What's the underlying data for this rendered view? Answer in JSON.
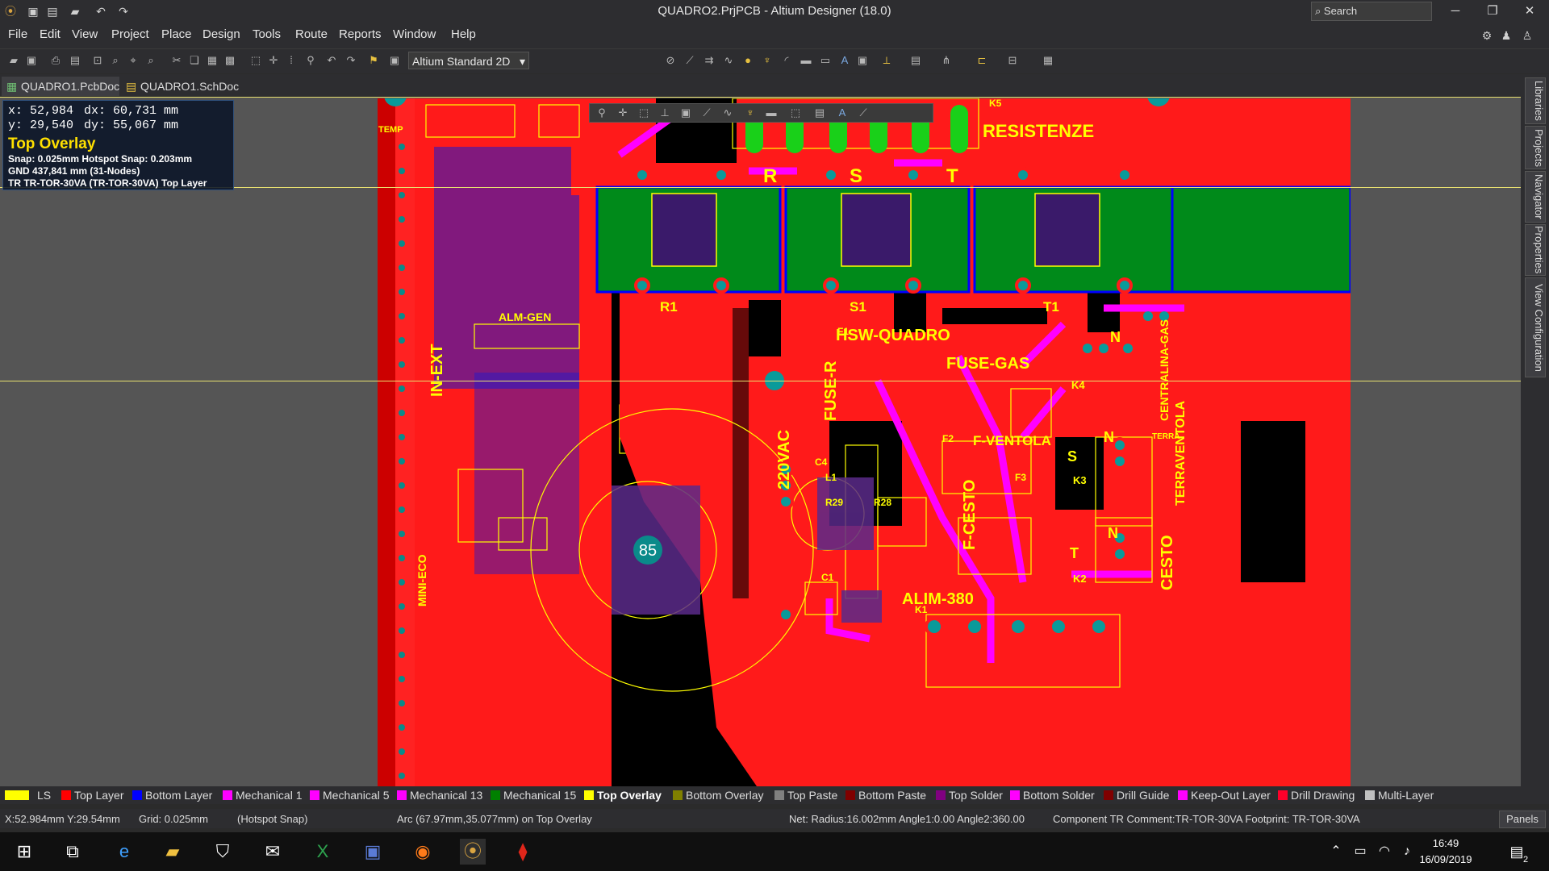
{
  "window": {
    "title": "QUADRO2.PrjPCB - Altium Designer (18.0)",
    "search_label": "Search"
  },
  "menu": [
    "File",
    "Edit",
    "View",
    "Project",
    "Place",
    "Design",
    "Tools",
    "Route",
    "Reports",
    "Window",
    "Help"
  ],
  "toolbar": {
    "view_config": "Altium Standard 2D"
  },
  "tabs": [
    {
      "label": "QUADRO1.PcbDoc",
      "active": true
    },
    {
      "label": "QUADRO1.SchDoc",
      "active": false
    }
  ],
  "hud": {
    "x": "x: 52,984",
    "dx": "dx: 60,731 mm",
    "y": "y: 29,540",
    "dy": "dy: 55,067 mm",
    "layer": "Top Overlay",
    "snap": "Snap: 0.025mm Hotspot Snap: 0.203mm",
    "net": "GND 437,841 mm (31-Nodes)",
    "component": "TR TR-TOR-30VA (TR-TOR-30VA) Top Layer"
  },
  "board_labels": {
    "resistenze": "RESISTENZE",
    "r": "R",
    "s": "S",
    "t": "T",
    "hsw_quadro": "HSW-QUADRO",
    "fuse_gas": "FUSE-GAS",
    "fuse_r": "FUSE-R",
    "f_ventola": "F-VENTOLA",
    "f_cesto": "F-CESTO",
    "vac": "220VAC",
    "alim_380": "ALIM-380",
    "alm_gen": "ALM-GEN",
    "in_ext": "IN-EXT",
    "mini_eco": "MINI-ECO",
    "cesto": "CESTO",
    "terra_ventola": "TERRAVENTOLA",
    "centralina_gas": "CENTRALINA-GAS",
    "pad_85": "85",
    "r1": "R1",
    "s1": "S1",
    "t1": "T1",
    "n": "N",
    "k5": "K5",
    "k4": "K4",
    "k3": "K3",
    "k2": "K2",
    "k1": "K1",
    "f1": "F1",
    "f2": "F2",
    "f3": "F3",
    "l1": "L1",
    "c1": "C1",
    "c4": "C4",
    "r28": "R28",
    "r29": "R29",
    "terra": "TERRA",
    "temp": "TEMP"
  },
  "layers": [
    {
      "name": "LS",
      "color": "#ffff00"
    },
    {
      "name": "Top Layer",
      "color": "#ff0000"
    },
    {
      "name": "Bottom Layer",
      "color": "#0000ff"
    },
    {
      "name": "Mechanical 1",
      "color": "#ff00ff"
    },
    {
      "name": "Mechanical 5",
      "color": "#ff00ff"
    },
    {
      "name": "Mechanical 13",
      "color": "#ff00ff"
    },
    {
      "name": "Mechanical 15",
      "color": "#008000"
    },
    {
      "name": "Top Overlay",
      "color": "#ffff00",
      "active": true
    },
    {
      "name": "Bottom Overlay",
      "color": "#808000"
    },
    {
      "name": "Top Paste",
      "color": "#808080"
    },
    {
      "name": "Bottom Paste",
      "color": "#800000"
    },
    {
      "name": "Top Solder",
      "color": "#800080"
    },
    {
      "name": "Bottom Solder",
      "color": "#ff00ff"
    },
    {
      "name": "Drill Guide",
      "color": "#800000"
    },
    {
      "name": "Keep-Out Layer",
      "color": "#ff00ff"
    },
    {
      "name": "Drill Drawing",
      "color": "#ff002a"
    },
    {
      "name": "Multi-Layer",
      "color": "#c0c0c0"
    }
  ],
  "status": {
    "coords": "X:52.984mm Y:29.54mm",
    "grid": "Grid: 0.025mm",
    "snap": "(Hotspot Snap)",
    "object": "Arc (67.97mm,35.077mm) on Top Overlay",
    "net": "Net:  Radius:16.002mm Angle1:0.00 Angle2:360.00",
    "component": "Component TR Comment:TR-TOR-30VA Footprint: TR-TOR-30VA",
    "panels": "Panels"
  },
  "right_panels": [
    "Libraries",
    "Projects",
    "Navigator",
    "Properties",
    "View Configuration"
  ],
  "taskbar": {
    "time": "16:49",
    "date": "16/09/2019",
    "notifications": "2"
  }
}
